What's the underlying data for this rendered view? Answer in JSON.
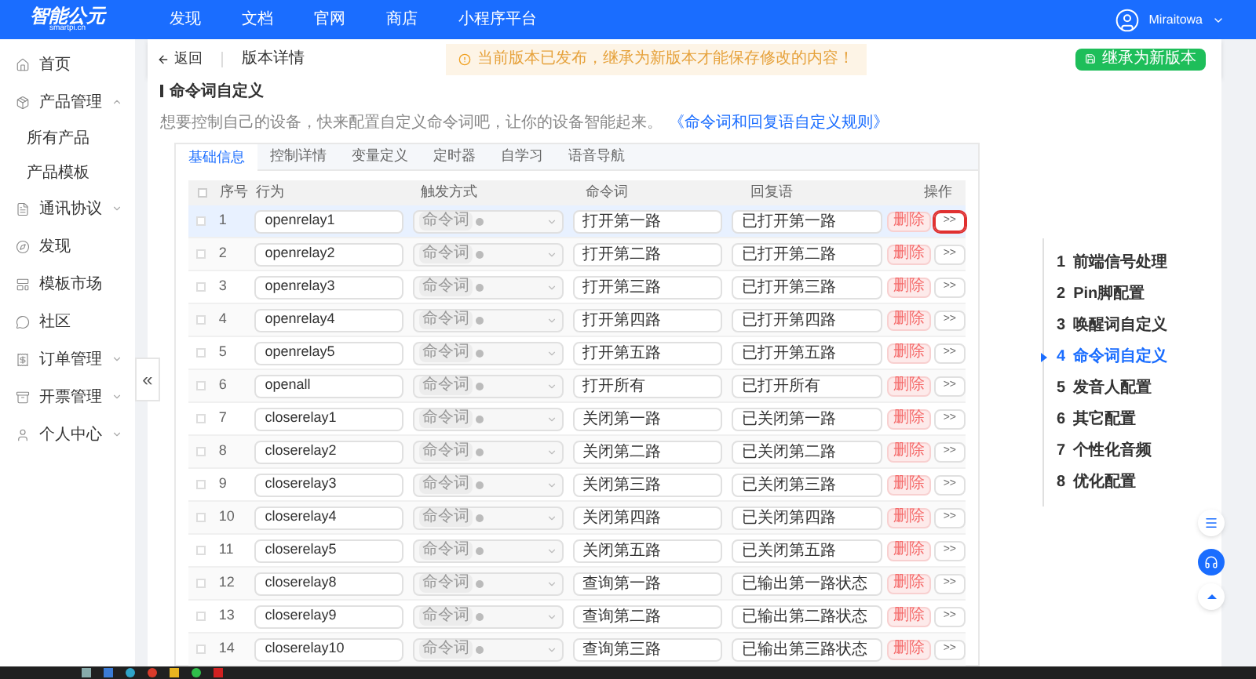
{
  "header": {
    "logo": "智能公元",
    "logo_sub": "smartpi.cn",
    "nav": [
      "发现",
      "文档",
      "官网",
      "商店",
      "小程序平台"
    ],
    "user": "Miraitowa"
  },
  "sidebar": {
    "items": [
      {
        "label": "首页",
        "kind": "link"
      },
      {
        "label": "产品管理",
        "kind": "group",
        "expanded": true,
        "children": [
          {
            "label": "所有产品"
          },
          {
            "label": "产品模板"
          }
        ]
      },
      {
        "label": "通讯协议",
        "kind": "group",
        "expanded": false
      },
      {
        "label": "发现",
        "kind": "link"
      },
      {
        "label": "模板市场",
        "kind": "link"
      },
      {
        "label": "社区",
        "kind": "link"
      },
      {
        "label": "订单管理",
        "kind": "group",
        "expanded": false
      },
      {
        "label": "开票管理",
        "kind": "group",
        "expanded": false
      },
      {
        "label": "个人中心",
        "kind": "group",
        "expanded": false
      }
    ],
    "collapse": "«"
  },
  "subheader": {
    "back": "返回",
    "title": "版本详情",
    "alert": "当前版本已发布，继承为新版本才能保存修改的内容！",
    "button": "继承为新版本"
  },
  "section": {
    "title": "命令词自定义",
    "description": "想要控制自己的设备，快来配置自定义命令词吧，让你的设备智能起来。",
    "link": "《命令词和回复语自定义规则》"
  },
  "tabs": [
    {
      "label": "基础信息",
      "selected": true
    },
    {
      "label": "控制详情",
      "selected": false
    },
    {
      "label": "变量定义",
      "selected": false
    },
    {
      "label": "定时器",
      "selected": false
    },
    {
      "label": "自学习",
      "selected": false
    },
    {
      "label": "语音导航",
      "selected": false
    }
  ],
  "table": {
    "all_checked": false,
    "columns": [
      "序号",
      "行为",
      "触发方式",
      "命令词",
      "回复语",
      "操作"
    ],
    "rows": [
      {
        "no": "1",
        "action": "openrelay1",
        "trigger": "命令词",
        "command": "打开第一路",
        "reply": "已打开第一路",
        "delete": "删除",
        "more": ">>",
        "selected": true,
        "annotated": true
      },
      {
        "no": "2",
        "action": "openrelay2",
        "trigger": "命令词",
        "command": "打开第二路",
        "reply": "已打开第二路",
        "delete": "删除",
        "more": ">>",
        "selected": false,
        "annotated": false
      },
      {
        "no": "3",
        "action": "openrelay3",
        "trigger": "命令词",
        "command": "打开第三路",
        "reply": "已打开第三路",
        "delete": "删除",
        "more": ">>",
        "selected": false,
        "annotated": false
      },
      {
        "no": "4",
        "action": "openrelay4",
        "trigger": "命令词",
        "command": "打开第四路",
        "reply": "已打开第四路",
        "delete": "删除",
        "more": ">>",
        "selected": false,
        "annotated": false
      },
      {
        "no": "5",
        "action": "openrelay5",
        "trigger": "命令词",
        "command": "打开第五路",
        "reply": "已打开第五路",
        "delete": "删除",
        "more": ">>",
        "selected": false,
        "annotated": false
      },
      {
        "no": "6",
        "action": "openall",
        "trigger": "命令词",
        "command": "打开所有",
        "reply": "已打开所有",
        "delete": "删除",
        "more": ">>",
        "selected": false,
        "annotated": false
      },
      {
        "no": "7",
        "action": "closerelay1",
        "trigger": "命令词",
        "command": "关闭第一路",
        "reply": "已关闭第一路",
        "delete": "删除",
        "more": ">>",
        "selected": false,
        "annotated": false
      },
      {
        "no": "8",
        "action": "closerelay2",
        "trigger": "命令词",
        "command": "关闭第二路",
        "reply": "已关闭第二路",
        "delete": "删除",
        "more": ">>",
        "selected": false,
        "annotated": false
      },
      {
        "no": "9",
        "action": "closerelay3",
        "trigger": "命令词",
        "command": "关闭第三路",
        "reply": "已关闭第三路",
        "delete": "删除",
        "more": ">>",
        "selected": false,
        "annotated": false
      },
      {
        "no": "10",
        "action": "closerelay4",
        "trigger": "命令词",
        "command": "关闭第四路",
        "reply": "已关闭第四路",
        "delete": "删除",
        "more": ">>",
        "selected": false,
        "annotated": false
      },
      {
        "no": "11",
        "action": "closerelay5",
        "trigger": "命令词",
        "command": "关闭第五路",
        "reply": "已关闭第五路",
        "delete": "删除",
        "more": ">>",
        "selected": false,
        "annotated": false
      },
      {
        "no": "12",
        "action": "closerelay8",
        "trigger": "命令词",
        "command": "查询第一路",
        "reply": "已输出第一路状态",
        "delete": "删除",
        "more": ">>",
        "selected": false,
        "annotated": false
      },
      {
        "no": "13",
        "action": "closerelay9",
        "trigger": "命令词",
        "command": "查询第二路",
        "reply": "已输出第二路状态",
        "delete": "删除",
        "more": ">>",
        "selected": false,
        "annotated": false
      },
      {
        "no": "14",
        "action": "closerelay10",
        "trigger": "命令词",
        "command": "查询第三路",
        "reply": "已输出第三路状态",
        "delete": "删除",
        "more": ">>",
        "selected": false,
        "annotated": false
      }
    ]
  },
  "steps": [
    {
      "number": "1",
      "label": "前端信号处理",
      "selected": false
    },
    {
      "number": "2",
      "label": "Pin脚配置",
      "selected": false
    },
    {
      "number": "3",
      "label": "唤醒词自定义",
      "selected": false
    },
    {
      "number": "4",
      "label": "命令词自定义",
      "selected": true
    },
    {
      "number": "5",
      "label": "发音人配置",
      "selected": false
    },
    {
      "number": "6",
      "label": "其它配置",
      "selected": false
    },
    {
      "number": "7",
      "label": "个性化音频",
      "selected": false
    },
    {
      "number": "8",
      "label": "优化配置",
      "selected": false
    }
  ]
}
